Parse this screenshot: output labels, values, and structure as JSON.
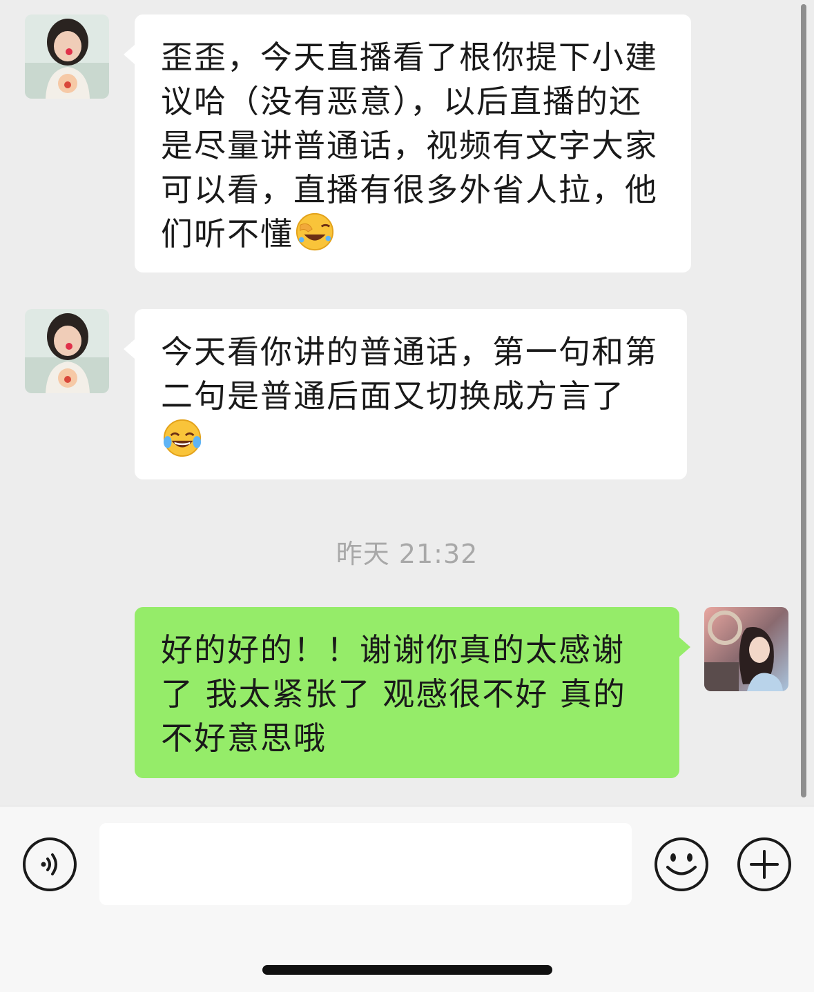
{
  "messages": [
    {
      "sender": "contact",
      "text": "歪歪，今天直播看了根你提下小建议哈（没有恶意），以后直播的还是尽量讲普通话，视频有文字大家可以看，直播有很多外省人拉，他们听不懂",
      "emoji": "facepalm-laughing-emoji"
    },
    {
      "sender": "contact",
      "text": "今天看你讲的普通话，第一句和第二句是普通后面又切换成方言了",
      "emoji": "tears-of-joy-emoji"
    },
    {
      "sender": "me",
      "text": "好的好的！！谢谢你真的太感谢了 我太紧张了 观感很不好 真的不好意思哦"
    }
  ],
  "timestamp": "昨天 21:32",
  "input_bar": {
    "voice_icon": "voice-icon",
    "emoji_icon": "smiley-icon",
    "plus_icon": "plus-icon",
    "input_value": ""
  },
  "colors": {
    "background": "#ededed",
    "incoming_bubble": "#ffffff",
    "outgoing_bubble": "#95ec69",
    "timestamp": "#a8a8a8"
  }
}
